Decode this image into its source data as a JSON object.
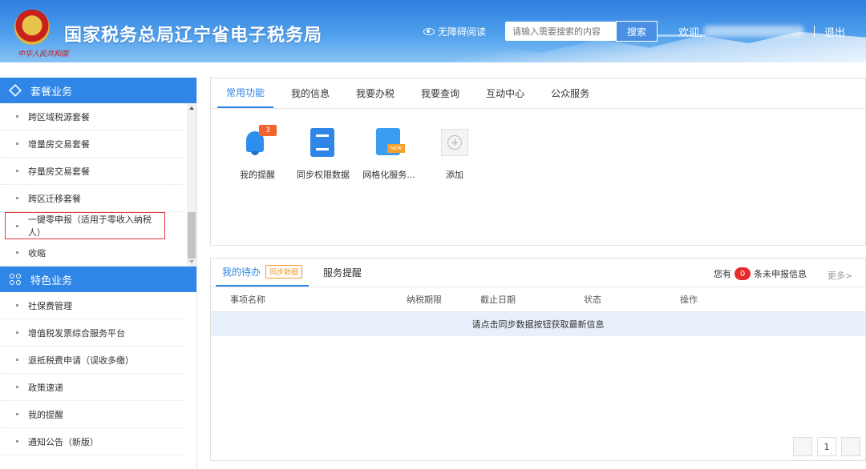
{
  "header": {
    "site_title": "国家税务总局辽宁省电子税务局",
    "emblem_caption": "中华人民共和国",
    "accessibility_label": "无障碍阅读",
    "search_placeholder": "请输入需要搜索的内容",
    "search_button": "搜索",
    "welcome": "欢迎,",
    "logout": "退出"
  },
  "sidebar": {
    "package_section": {
      "title": "套餐业务",
      "items": [
        "跨区域税源套餐",
        "增量房交易套餐",
        "存量房交易套餐",
        "跨区迁移套餐",
        "一键零申报（适用于零收入纳税人）",
        "收缩"
      ]
    },
    "special_section": {
      "title": "特色业务",
      "items": [
        "社保费管理",
        "增值税发票综合服务平台",
        "退抵税费申请（误收多缴）",
        "政策速递",
        "我的提醒",
        "通知公告（新版）"
      ]
    }
  },
  "functions_panel": {
    "tabs": [
      "常用功能",
      "我的信息",
      "我要办税",
      "我要查询",
      "互动中心",
      "公众服务"
    ],
    "active_tab": 0,
    "apps": [
      {
        "label": "我的提醒",
        "icon": "bell-icon",
        "badge": "3"
      },
      {
        "label": "同步权限数据",
        "icon": "sync-data-icon"
      },
      {
        "label": "网格化服务...",
        "icon": "grid-service-icon"
      },
      {
        "label": "添加",
        "icon": "add-icon"
      }
    ]
  },
  "todo_panel": {
    "tabs": [
      "我的待办",
      "服务提醒"
    ],
    "sync_tag": "同步数据",
    "pending_prefix": "您有",
    "pending_count": "0",
    "pending_suffix": "条未申报信息",
    "more": "更多>",
    "columns": [
      "事项名称",
      "纳税期限",
      "截止日期",
      "状态",
      "操作"
    ],
    "empty_message": "请点击同步数据按钮获取最新信息",
    "page": "1"
  },
  "colors": {
    "accent": "#2f86e6",
    "selected_border": "#e5393a",
    "badge": "#f2622b"
  }
}
